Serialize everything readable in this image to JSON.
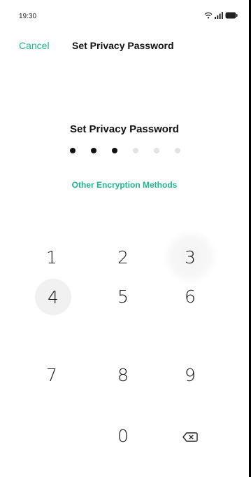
{
  "status_bar": {
    "time": "19:30",
    "icons": [
      "wifi-icon",
      "signal-icon",
      "battery-icon"
    ]
  },
  "nav": {
    "cancel_label": "Cancel",
    "title": "Set Privacy Password"
  },
  "main": {
    "title": "Set Privacy Password",
    "pin": {
      "length": 6,
      "entered": 3
    },
    "other_methods_label": "Other Encryption Methods"
  },
  "keypad": {
    "keys": [
      "1",
      "2",
      "3",
      "4",
      "5",
      "6",
      "7",
      "8",
      "9",
      "0"
    ],
    "delete_icon": "backspace-icon"
  },
  "colors": {
    "accent": "#1fb58d",
    "dot_filled": "#111111",
    "dot_empty": "#e3e3e3",
    "pressed_key": "#f1f1f1"
  }
}
